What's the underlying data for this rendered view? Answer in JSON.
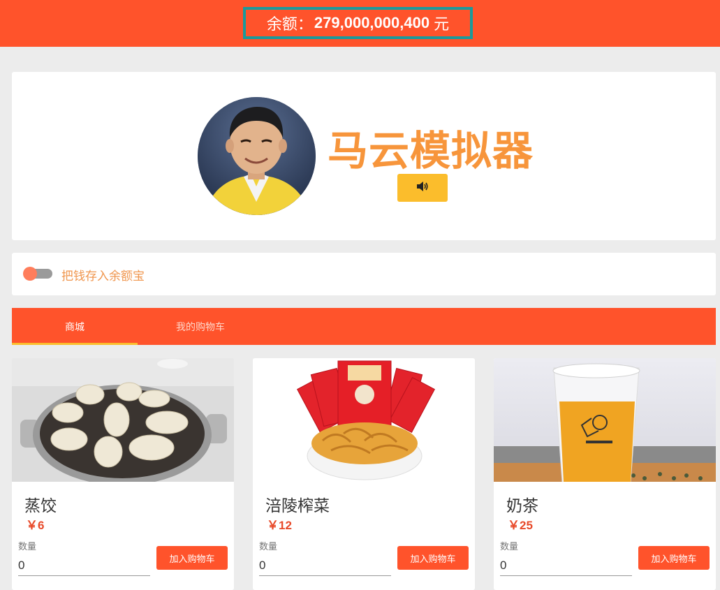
{
  "header": {
    "balance_label": "余额：",
    "balance_amount": "279,000,000,400",
    "balance_unit": "元"
  },
  "profile": {
    "title": "马云模拟器",
    "sound_icon": "speaker-icon"
  },
  "toggle": {
    "label": "把钱存入余额宝",
    "checked": false
  },
  "tabs": [
    {
      "label": "商城",
      "active": true
    },
    {
      "label": "我的购物车",
      "active": false
    }
  ],
  "products": [
    {
      "name": "蒸饺",
      "price": "￥6",
      "qty_label": "数量",
      "qty": "0",
      "add_label": "加入购物车"
    },
    {
      "name": "涪陵榨菜",
      "price": "￥12",
      "qty_label": "数量",
      "qty": "0",
      "add_label": "加入购物车"
    },
    {
      "name": "奶茶",
      "price": "￥25",
      "qty_label": "数量",
      "qty": "0",
      "add_label": "加入购物车"
    }
  ],
  "colors": {
    "primary": "#ff532b",
    "accent": "#fbbd2c",
    "title": "#f7953b",
    "price": "#e84a2a",
    "highlight_border": "#1a9a9b"
  }
}
